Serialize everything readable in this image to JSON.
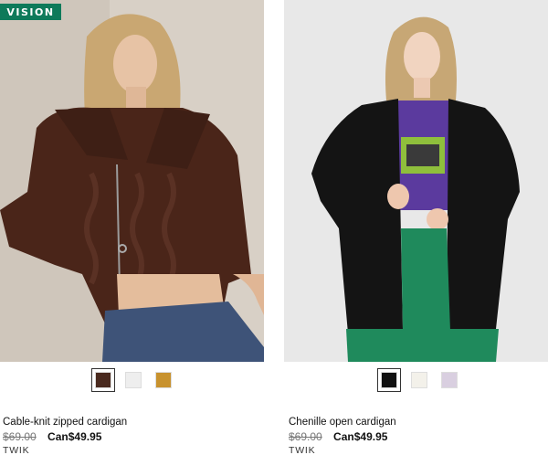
{
  "products": [
    {
      "badge": "VISION",
      "name": "Cable-knit zipped cardigan",
      "old_price": "$69.00",
      "new_price": "Can$49.95",
      "brand": "TWIK",
      "image_alt": "model wearing brown cable-knit zipped cardigan",
      "swatches": [
        {
          "color": "#4a2a1f",
          "selected": true
        },
        {
          "color": "#eeeeee",
          "selected": false
        },
        {
          "color": "#c8922e",
          "selected": false
        }
      ]
    },
    {
      "name": "Chenille open cardigan",
      "old_price": "$69.00",
      "new_price": "Can$49.95",
      "brand": "TWIK",
      "image_alt": "model wearing black chenille open cardigan",
      "swatches": [
        {
          "color": "#111111",
          "selected": true
        },
        {
          "color": "#f3f1ea",
          "selected": false
        },
        {
          "color": "#d9cfe0",
          "selected": false
        }
      ]
    }
  ]
}
